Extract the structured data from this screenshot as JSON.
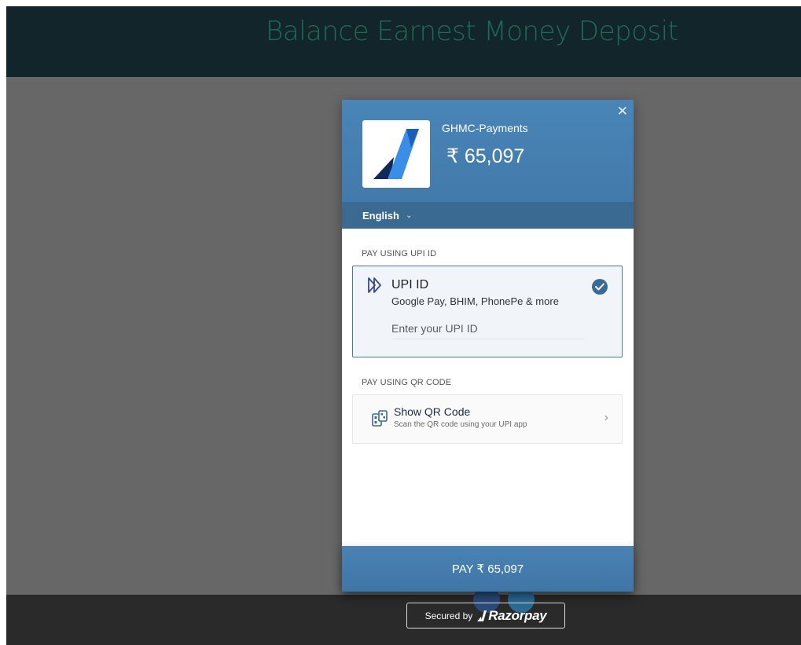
{
  "page": {
    "title": "Balance Earnest Money Deposit"
  },
  "footer": {
    "secured_by": "Secured by",
    "brand": "Razorpay"
  },
  "modal": {
    "merchant_name": "GHMC-Payments",
    "amount": "₹ 65,097",
    "language": "English",
    "sections": {
      "upi_label": "PAY USING UPI ID",
      "qr_label": "PAY USING QR CODE"
    },
    "upi": {
      "title": "UPI ID",
      "subtitle": "Google Pay, BHIM, PhonePe & more",
      "placeholder": "Enter your UPI ID",
      "selected": true
    },
    "qr": {
      "title": "Show QR Code",
      "subtitle": "Scan the QR code using your UPI app"
    },
    "pay_button": "PAY ₹ 65,097"
  },
  "icons": {
    "close": "close-icon",
    "language_caret": "chevron-down-icon",
    "upi": "upi-icon",
    "check": "check-icon",
    "qr": "qr-code-icon",
    "chevron": "chevron-right-icon"
  },
  "colors": {
    "header_band": "#11252b",
    "title_text": "#1f6a55",
    "overlay": "#676767",
    "modal_header": "#4a85b8",
    "accent": "#3a6a96",
    "footer": "#2a2a2a"
  }
}
